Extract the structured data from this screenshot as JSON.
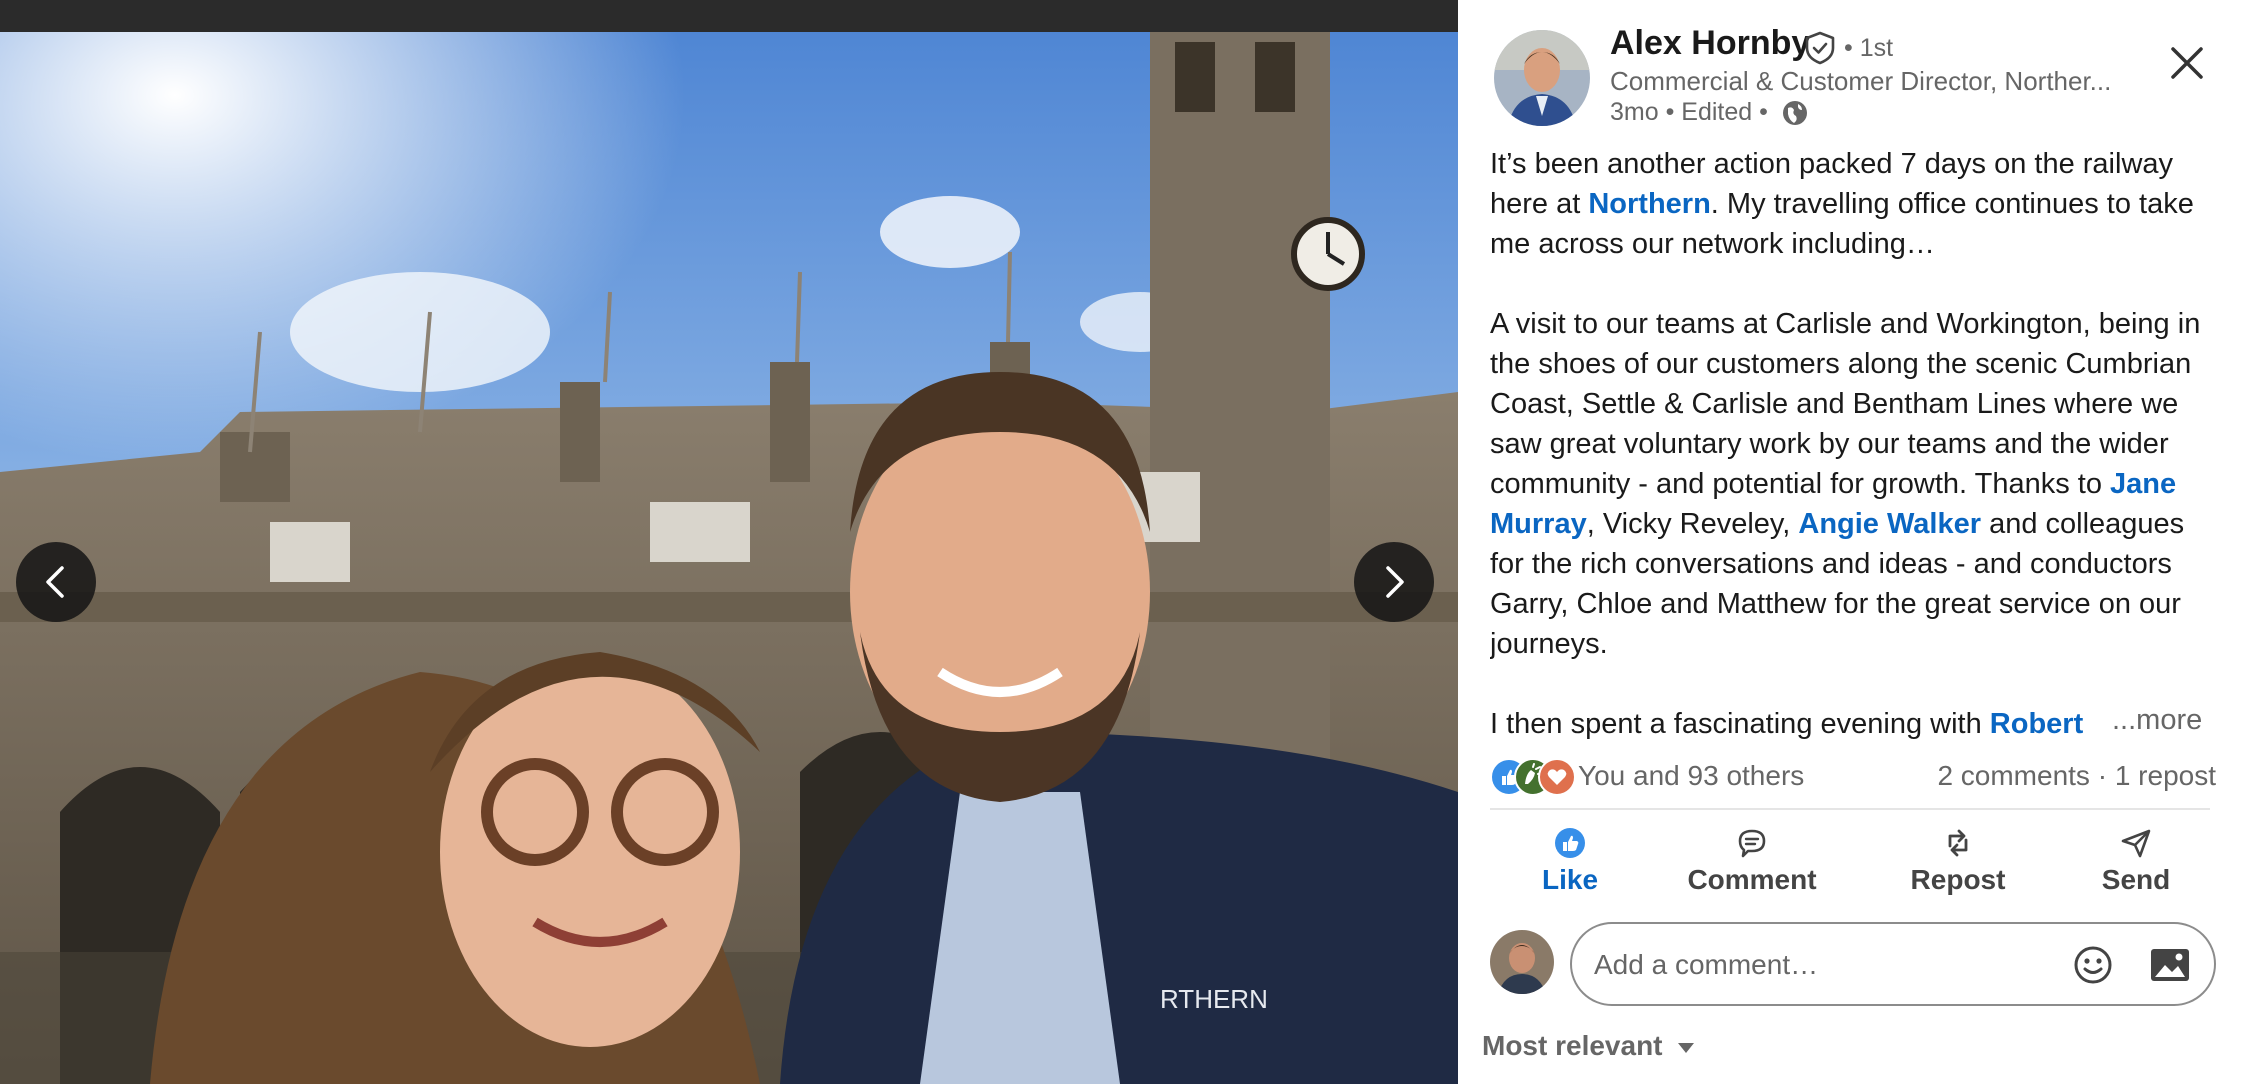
{
  "post": {
    "author": {
      "name": "Alex Hornby",
      "degree": "• 1st",
      "headline": "Commercial & Customer Director, Norther...",
      "meta": "3mo • Edited •",
      "verified_icon": "verified-shield-icon",
      "visibility_icon": "globe-icon"
    },
    "close_icon": "close-icon",
    "text": {
      "p1_a": "It’s been another action packed 7 days on the railway here at ",
      "p1_mention": "Northern",
      "p1_b": ". My travelling office continues to take me across our network including…",
      "p2_a": "A visit to our teams at Carlisle and Workington, being in the shoes of our customers along the scenic Cumbrian Coast, Settle & Carlisle and Bentham Lines where we saw great voluntary work by our teams and the wider community - and potential for growth. Thanks to ",
      "p2_mention1": "Jane Murray",
      "p2_b": ", Vicky Reveley, ",
      "p2_mention2": "Angie Walker",
      "p2_c": " and colleagues for the rich conversations and ideas - and conductors Garry, Chloe and Matthew for the great service on our journeys.",
      "p3_a": "I then spent a fascinating evening with ",
      "p3_mention": "Robert"
    },
    "see_more": "...more",
    "reactions": {
      "icons": [
        "like-icon",
        "celebrate-icon",
        "love-icon"
      ],
      "count_text": "You and 93 others",
      "engagement_text": "2 comments · 1 repost"
    },
    "actions": {
      "like": "Like",
      "comment": "Comment",
      "repost": "Repost",
      "send": "Send"
    },
    "comment_box": {
      "placeholder": "Add a comment…",
      "emoji_icon": "emoji-icon",
      "photo_icon": "image-icon"
    },
    "sort_label": "Most relevant"
  },
  "media": {
    "prev_icon": "chevron-left-icon",
    "next_icon": "chevron-right-icon"
  },
  "colors": {
    "accent": "#0a66c2",
    "reaction_like": "#378fe9",
    "reaction_celebrate": "#44712e",
    "reaction_love": "#df704d"
  }
}
